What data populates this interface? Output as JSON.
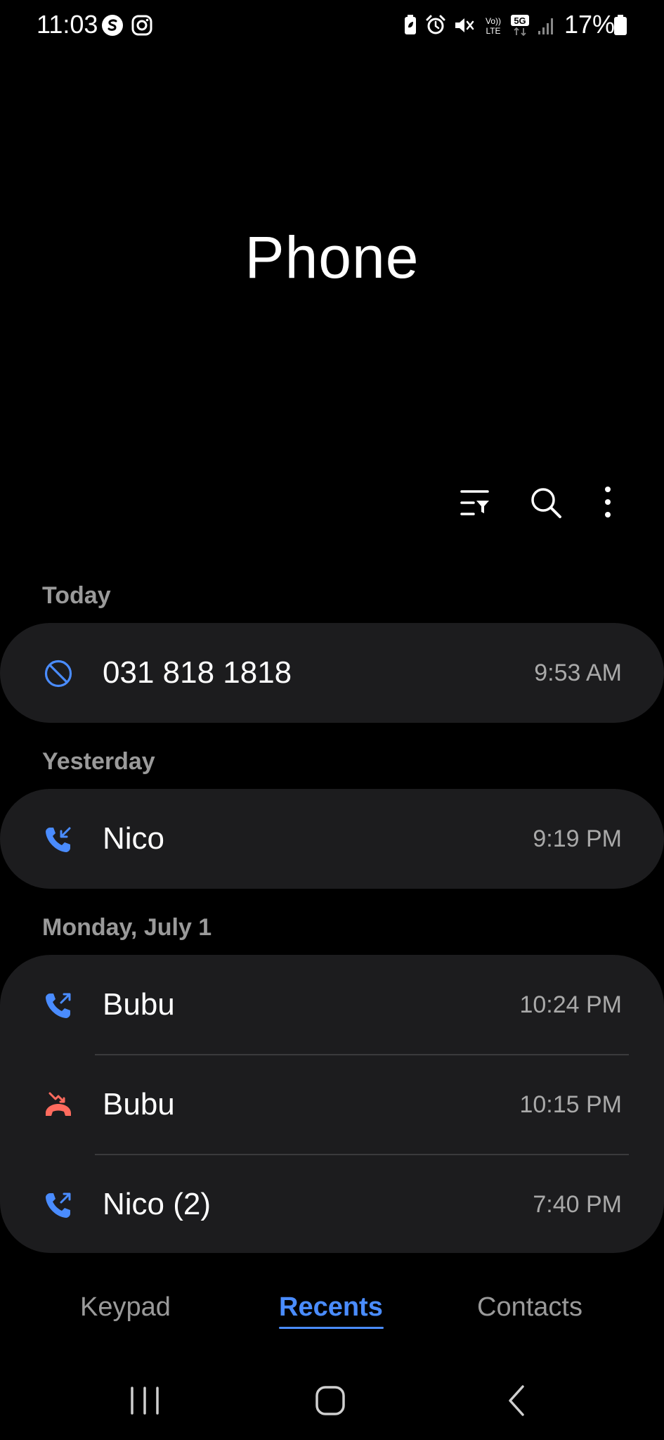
{
  "status_bar": {
    "time": "11:03",
    "battery": "17%",
    "icons": [
      "samsung-s-icon",
      "instagram-icon",
      "battery-saver-icon",
      "alarm-icon",
      "mute-icon",
      "volte-icon",
      "5g-icon",
      "signal-icon",
      "battery-icon"
    ]
  },
  "app": {
    "title": "Phone"
  },
  "toolbar": {
    "icons": [
      "filter-icon",
      "search-icon",
      "more-options-icon"
    ]
  },
  "sections": {
    "today": {
      "header": "Today",
      "calls": [
        {
          "name": "031 818 1818",
          "time": "9:53 AM",
          "type": "blocked"
        }
      ]
    },
    "yesterday": {
      "header": "Yesterday",
      "calls": [
        {
          "name": "Nico",
          "time": "9:19 PM",
          "type": "incoming"
        }
      ]
    },
    "monday": {
      "header": "Monday, July 1",
      "calls": [
        {
          "name": "Bubu",
          "time": "10:24 PM",
          "type": "outgoing"
        },
        {
          "name": "Bubu",
          "time": "10:15 PM",
          "type": "missed"
        },
        {
          "name": "Nico (2)",
          "time": "7:40 PM",
          "type": "outgoing"
        }
      ]
    }
  },
  "tabs": {
    "keypad": "Keypad",
    "recents": "Recents",
    "contacts": "Contacts",
    "active": "recents"
  },
  "colors": {
    "background": "#000000",
    "card": "#1c1c1e",
    "accent": "#4a8cff",
    "missed": "#ff6b5e",
    "secondary_text": "#9a9a9a"
  },
  "nav_bar": {
    "icons": [
      "recent-apps-icon",
      "home-icon",
      "back-icon"
    ]
  }
}
